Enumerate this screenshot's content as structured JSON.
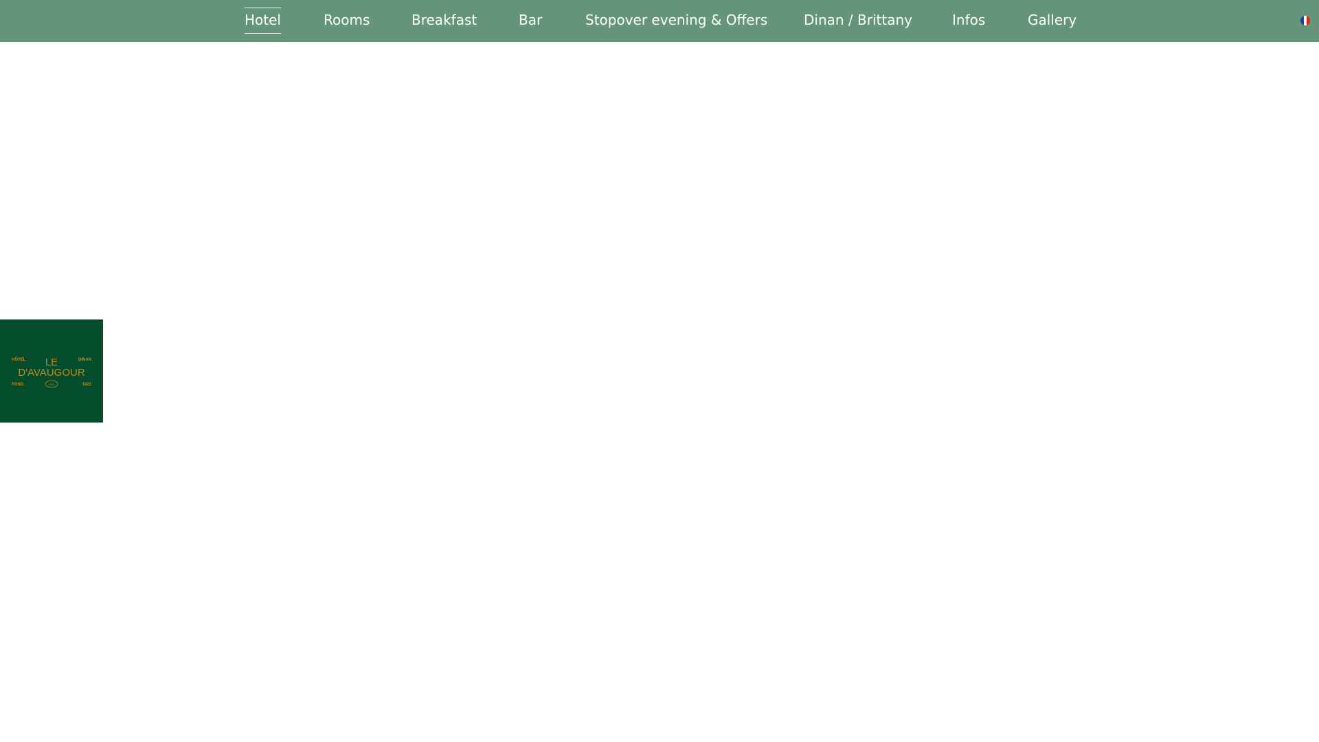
{
  "nav": {
    "items": [
      {
        "label": "Hotel",
        "active": true
      },
      {
        "label": "Rooms"
      },
      {
        "label": "Breakfast"
      },
      {
        "label": "Bar"
      },
      {
        "label": "Stopover evening & Offers"
      },
      {
        "label": "Dinan / Brittany"
      },
      {
        "label": "Infos"
      },
      {
        "label": "Gallery"
      }
    ]
  },
  "language": {
    "icon": "french-flag-icon"
  },
  "logo": {
    "top_left": "HÔTEL",
    "top_right": "DINAN",
    "line1": "LE",
    "line2": "D'AVAUGOUR",
    "bottom_left": "FOND.",
    "bottom_right": "1822",
    "emblem": "LDA"
  },
  "colors": {
    "nav_bg": "#64957a",
    "logo_bg": "#044d2c",
    "logo_text": "#c28a1e",
    "nav_text": "#ffffff"
  }
}
